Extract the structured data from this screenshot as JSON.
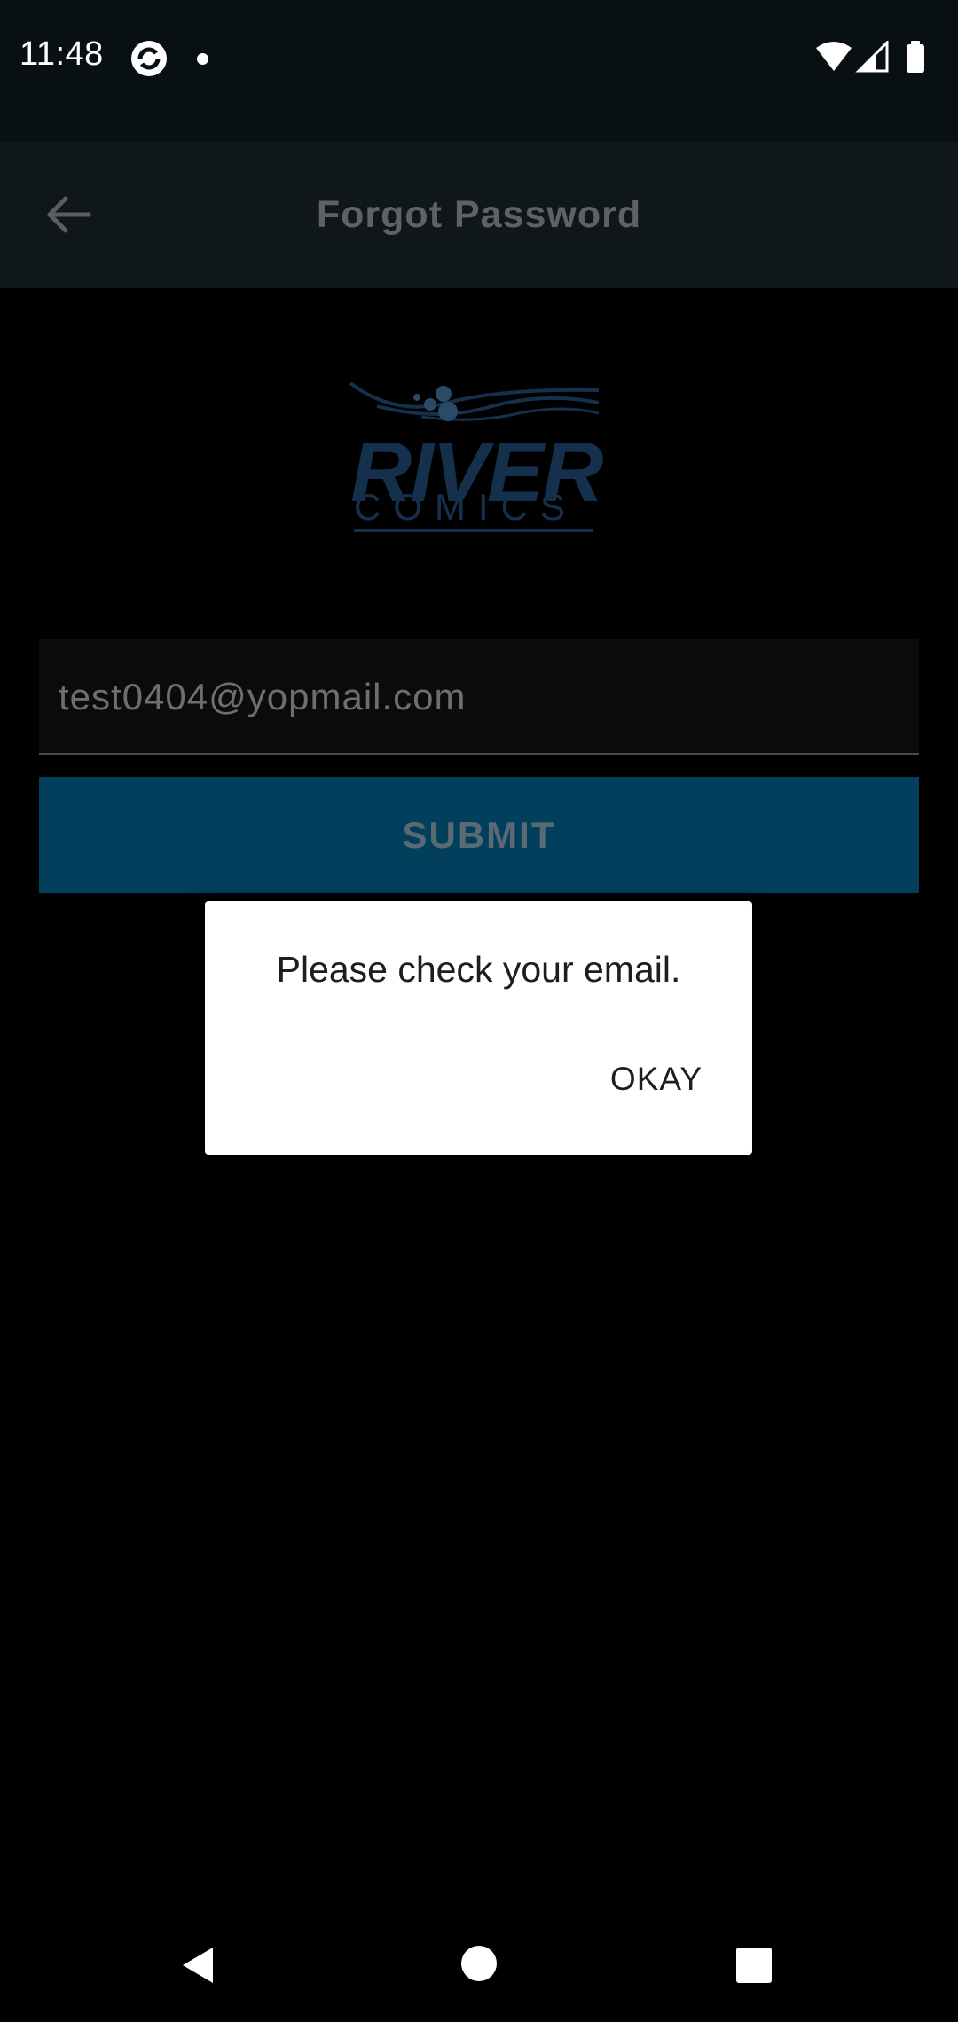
{
  "status_bar": {
    "time": "11:48"
  },
  "app_bar": {
    "title": "Forgot Password"
  },
  "logo": {
    "line1": "RIVER",
    "line2": "COMICS"
  },
  "form": {
    "email_value": "test0404@yopmail.com",
    "submit_label": "SUBMIT"
  },
  "dialog": {
    "message": "Please check your email.",
    "okay_label": "OKAY"
  },
  "colors": {
    "status_bar_bg": "#091014",
    "app_bar_bg": "#0f1719",
    "submit_bg": "#023f5c",
    "logo_color": "#14304c",
    "dialog_bg": "#ffffff"
  }
}
